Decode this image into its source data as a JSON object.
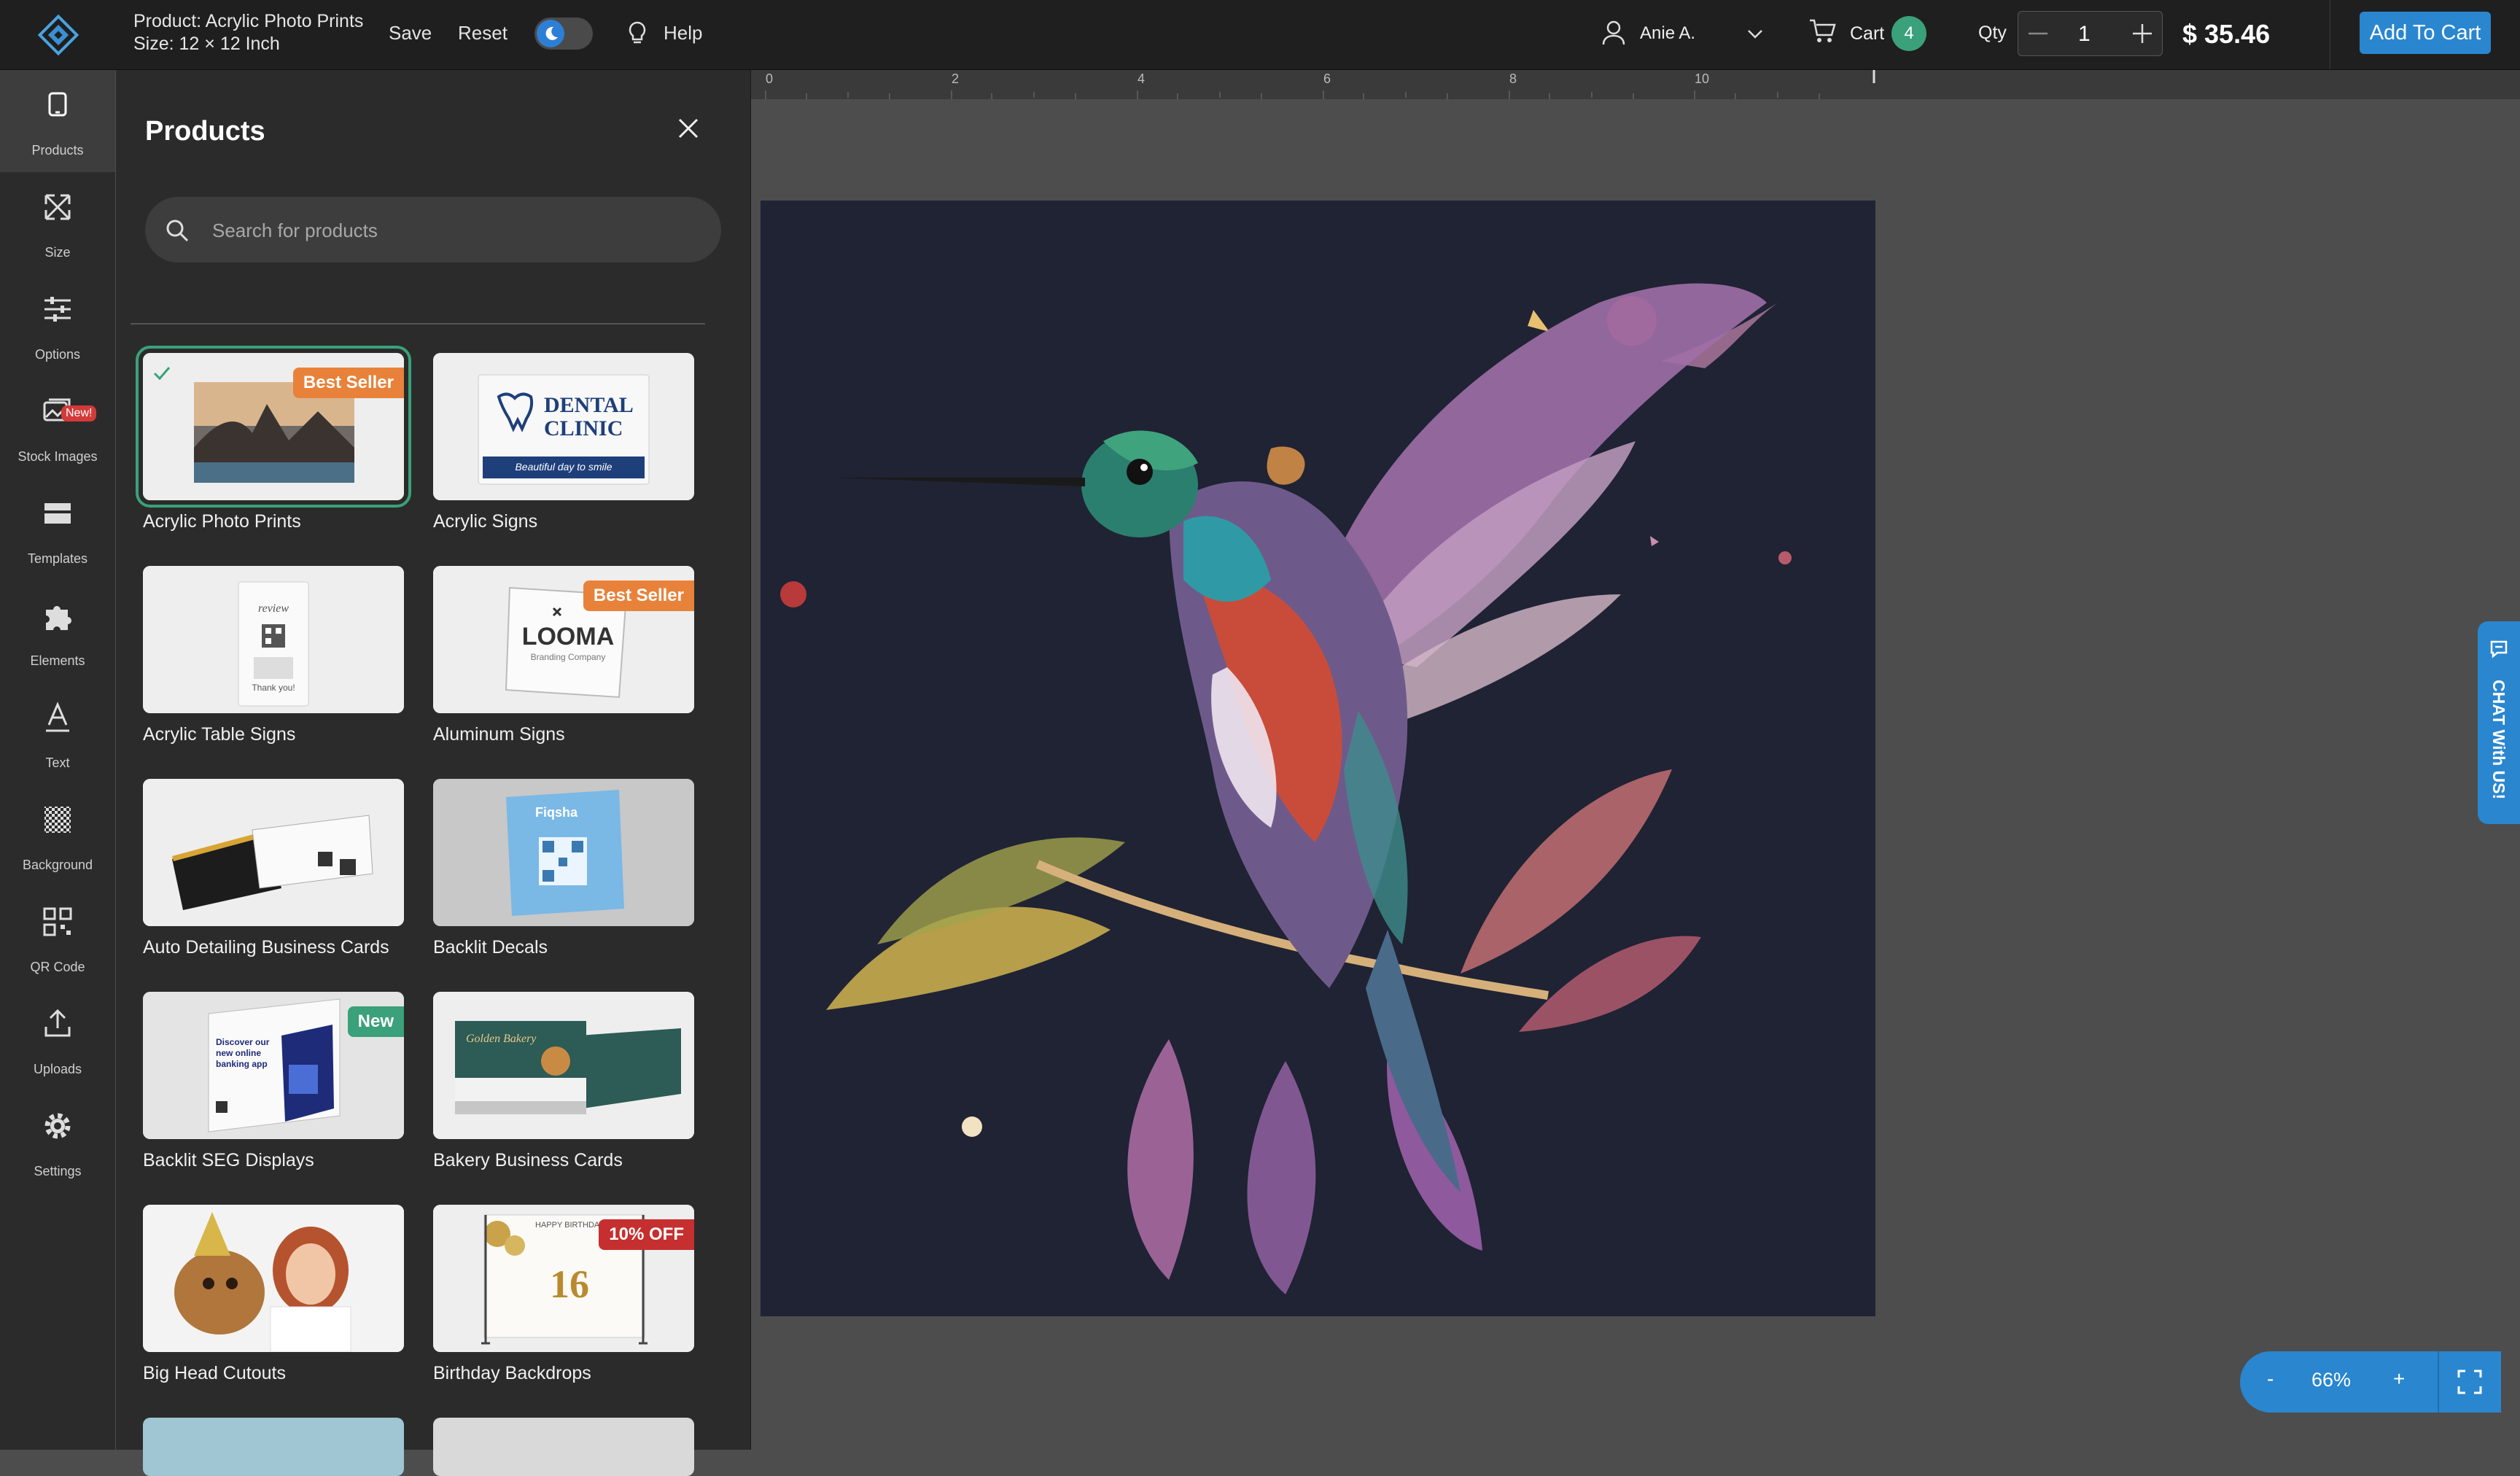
{
  "topbar": {
    "product_line": "Product: Acrylic Photo Prints",
    "size_line": "Size: 12 × 12 Inch",
    "save_label": "Save",
    "reset_label": "Reset",
    "help_label": "Help",
    "user_name": "Anie A.",
    "cart_label": "Cart",
    "cart_count": "4",
    "qty_label": "Qty",
    "qty_value": "1",
    "price": "$ 35.46",
    "add_to_cart_label": "Add To Cart"
  },
  "sidebar": {
    "items": [
      {
        "label": "Products",
        "icon": "tablet-icon"
      },
      {
        "label": "Size",
        "icon": "resize-icon"
      },
      {
        "label": "Options",
        "icon": "sliders-icon"
      },
      {
        "label": "Stock Images",
        "icon": "images-icon",
        "badge": "New!"
      },
      {
        "label": "Templates",
        "icon": "templates-icon"
      },
      {
        "label": "Elements",
        "icon": "puzzle-icon"
      },
      {
        "label": "Text",
        "icon": "text-icon"
      },
      {
        "label": "Background",
        "icon": "checker-icon"
      },
      {
        "label": "QR Code",
        "icon": "qr-icon"
      },
      {
        "label": "Uploads",
        "icon": "upload-icon"
      },
      {
        "label": "Settings",
        "icon": "gear-icon"
      }
    ]
  },
  "panel": {
    "title": "Products",
    "search_placeholder": "Search for products",
    "products": [
      {
        "label": "Acrylic Photo Prints",
        "badge": "Best Seller",
        "badge_color": "#e8823a",
        "selected": true
      },
      {
        "label": "Acrylic Signs"
      },
      {
        "label": "Acrylic Table Signs"
      },
      {
        "label": "Aluminum Signs",
        "badge": "Best Seller",
        "badge_color": "#e8823a"
      },
      {
        "label": "Auto Detailing Business Cards"
      },
      {
        "label": "Backlit Decals"
      },
      {
        "label": "Backlit SEG Displays",
        "badge": "New",
        "badge_color": "#3aa17a"
      },
      {
        "label": "Bakery Business Cards"
      },
      {
        "label": "Big Head Cutouts"
      },
      {
        "label": "Birthday Backdrops",
        "badge": "10% OFF",
        "badge_color": "#c62f2f"
      }
    ],
    "thumb_text": {
      "dental_name": "DENTAL CLINIC",
      "dental_tag": "Beautiful day to smile",
      "review_title": "review",
      "review_thanks": "Thank you!",
      "looma_name": "LOOMA",
      "looma_sub": "Branding Company",
      "decal_brand": "Fiqsha",
      "seg_text": "Discover our new online banking app",
      "bakery_name": "Golden Bakery",
      "birthday_head": "HAPPY BIRTHDAY",
      "birthday_num": "16"
    }
  },
  "ruler": {
    "ticks": [
      "0",
      "2",
      "4",
      "6",
      "8",
      "10"
    ]
  },
  "zoom": {
    "minus": "-",
    "value": "66%",
    "plus": "+"
  },
  "chat": {
    "label": "CHAT With US!"
  },
  "colors": {
    "accent": "#2a86cf",
    "success": "#3aa17a",
    "topbar_bg": "#1f1f1f",
    "panel_bg": "#2b2b2b",
    "canvas_bg": "#4d4d4d",
    "artboard_bg": "#1f2333"
  }
}
